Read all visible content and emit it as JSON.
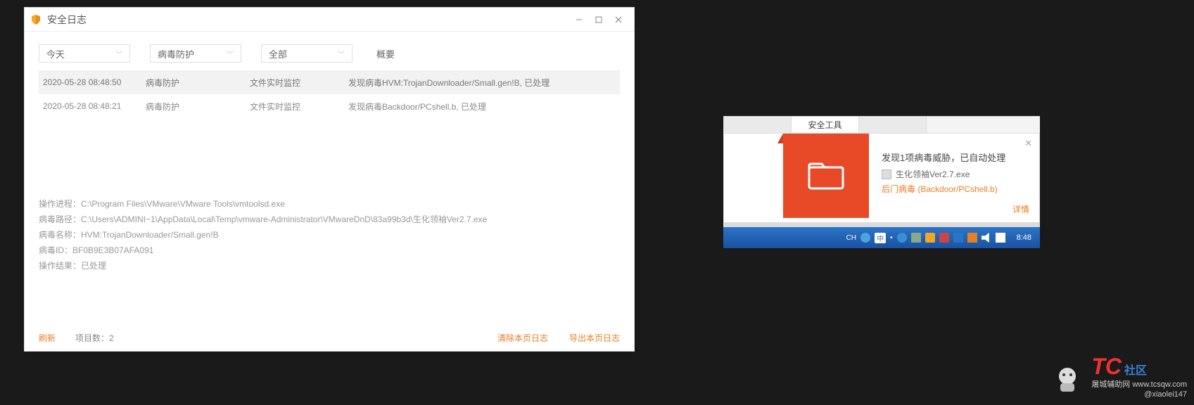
{
  "log_window": {
    "title": "安全日志",
    "filters": {
      "date": "今天",
      "category": "病毒防护",
      "scope": "全部",
      "summary_header": "概要"
    },
    "rows": [
      {
        "time": "2020-05-28 08:48:50",
        "type": "病毒防护",
        "source": "文件实时监控",
        "summary": "发现病毒HVM:TrojanDownloader/Small.gen!B, 已处理"
      },
      {
        "time": "2020-05-28 08:48:21",
        "type": "病毒防护",
        "source": "文件实时监控",
        "summary": "发现病毒Backdoor/PCshell.b, 已处理"
      }
    ],
    "details": {
      "proc": "操作进程：C:\\Program Files\\VMware\\VMware Tools\\vmtoolsd.exe",
      "path": "病毒路径：C:\\Users\\ADMINI~1\\AppData\\Local\\Temp\\vmware-Administrator\\VMwareDnD\\83a99b3d\\生化领袖Ver2.7.exe",
      "name": "病毒名称：HVM:TrojanDownloader/Small.gen!B",
      "id": "病毒ID：BF0B9E3B07AFA091",
      "result": "操作结果：已处理"
    },
    "footer": {
      "refresh": "刷新",
      "count": "项目数：2",
      "clear": "清除本页日志",
      "export": "导出本页日志"
    }
  },
  "notification": {
    "tab_label": "安全工具",
    "title": "发现1项病毒威胁，已自动处理",
    "file": "生化领袖Ver2.7.exe",
    "threat": "后门病毒 (Backdoor/PCshell.b)",
    "detail_link": "详情"
  },
  "taskbar": {
    "ime_lang": "CH",
    "ime_indicator": "中",
    "clock": "8:48"
  },
  "watermark": {
    "brand_main": "TC",
    "brand_sub": "社区",
    "site": "屠城辅助网 www.tcsqw.com",
    "handle": "@xiaolei147"
  },
  "icons": {
    "minimize": "minimize-icon",
    "maximize": "maximize-icon",
    "close": "close-icon",
    "chevron": "chevron-down-icon",
    "folder": "folder-icon",
    "shield": "shield-icon"
  }
}
